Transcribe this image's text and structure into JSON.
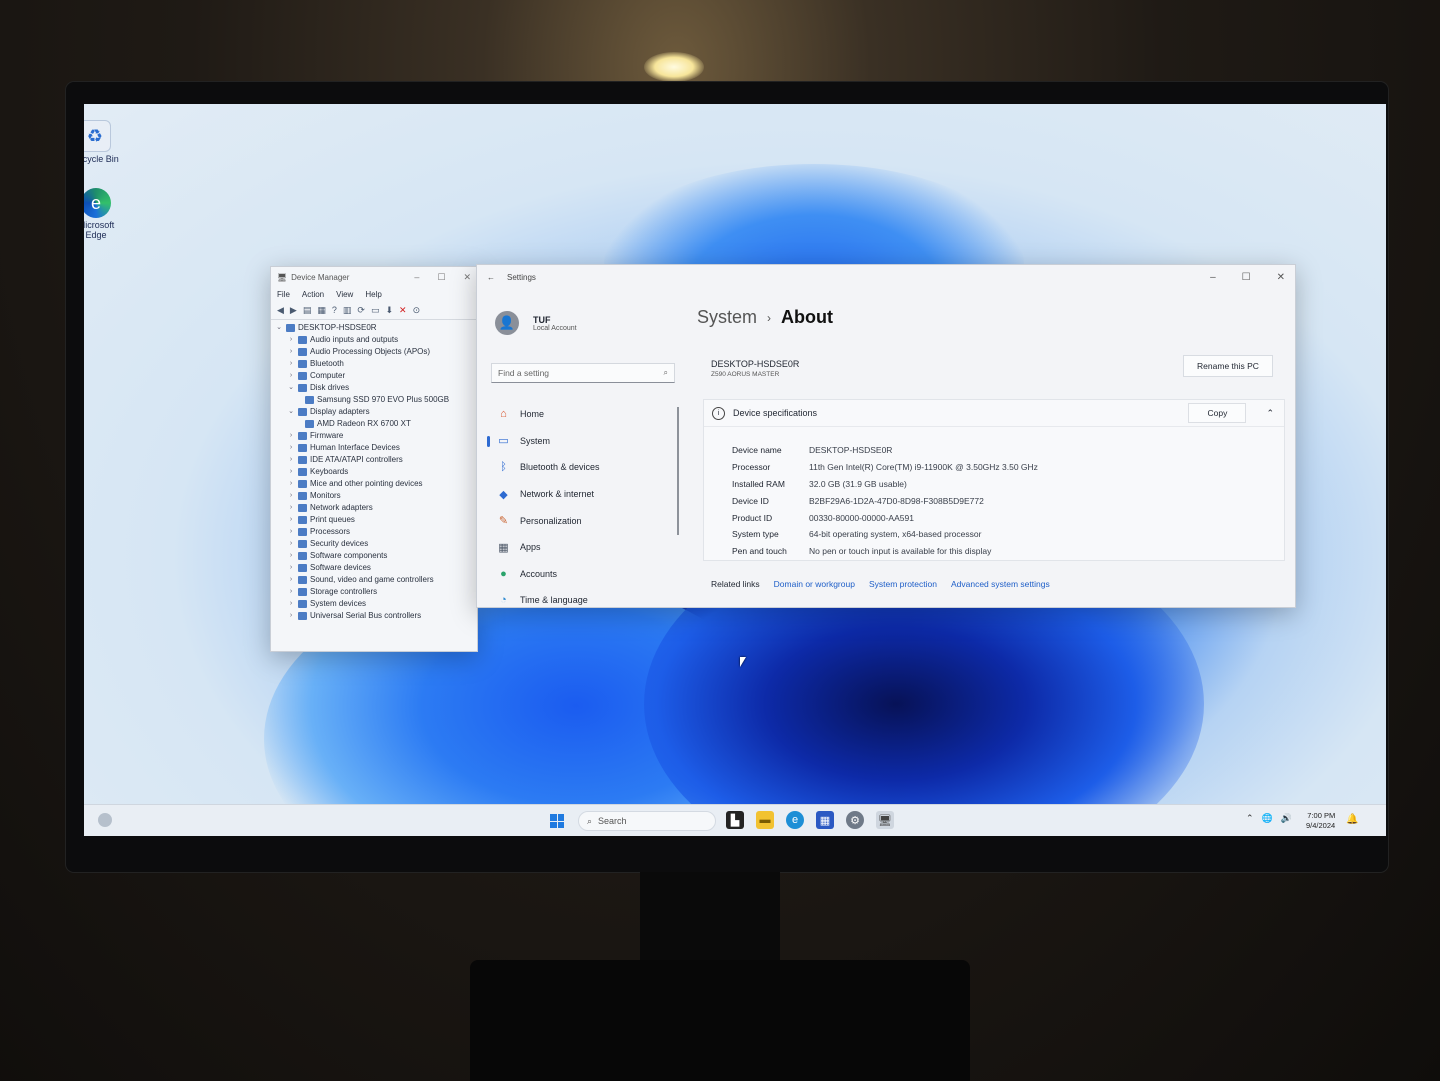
{
  "desktop": {
    "icons": [
      {
        "label": "Recycle Bin",
        "icon": "recycle-bin-icon"
      },
      {
        "label": "Microsoft Edge",
        "icon": "edge-icon"
      }
    ]
  },
  "device_manager": {
    "title": "Device Manager",
    "menu": [
      "File",
      "Action",
      "View",
      "Help"
    ],
    "tree": [
      {
        "label": "DESKTOP-HSDSE0R",
        "level": 0,
        "expanded": true
      },
      {
        "label": "Audio inputs and outputs",
        "level": 1
      },
      {
        "label": "Audio Processing Objects (APOs)",
        "level": 1
      },
      {
        "label": "Bluetooth",
        "level": 1
      },
      {
        "label": "Computer",
        "level": 1
      },
      {
        "label": "Disk drives",
        "level": 1,
        "expanded": true
      },
      {
        "label": "Samsung SSD 970 EVO Plus 500GB",
        "level": 2
      },
      {
        "label": "Display adapters",
        "level": 1,
        "expanded": true
      },
      {
        "label": "AMD Radeon RX 6700 XT",
        "level": 2
      },
      {
        "label": "Firmware",
        "level": 1
      },
      {
        "label": "Human Interface Devices",
        "level": 1
      },
      {
        "label": "IDE ATA/ATAPI controllers",
        "level": 1
      },
      {
        "label": "Keyboards",
        "level": 1
      },
      {
        "label": "Mice and other pointing devices",
        "level": 1
      },
      {
        "label": "Monitors",
        "level": 1
      },
      {
        "label": "Network adapters",
        "level": 1
      },
      {
        "label": "Print queues",
        "level": 1
      },
      {
        "label": "Processors",
        "level": 1
      },
      {
        "label": "Security devices",
        "level": 1
      },
      {
        "label": "Software components",
        "level": 1
      },
      {
        "label": "Software devices",
        "level": 1
      },
      {
        "label": "Sound, video and game controllers",
        "level": 1
      },
      {
        "label": "Storage controllers",
        "level": 1
      },
      {
        "label": "System devices",
        "level": 1
      },
      {
        "label": "Universal Serial Bus controllers",
        "level": 1
      }
    ]
  },
  "settings": {
    "title": "Settings",
    "profile": {
      "name": "TUF",
      "account": "Local Account"
    },
    "search_placeholder": "Find a setting",
    "nav": [
      {
        "label": "Home",
        "icon": "home-icon",
        "active": false
      },
      {
        "label": "System",
        "icon": "system-icon",
        "active": true
      },
      {
        "label": "Bluetooth & devices",
        "icon": "bluetooth-icon",
        "active": false
      },
      {
        "label": "Network & internet",
        "icon": "network-icon",
        "active": false
      },
      {
        "label": "Personalization",
        "icon": "brush-icon",
        "active": false
      },
      {
        "label": "Apps",
        "icon": "apps-icon",
        "active": false
      },
      {
        "label": "Accounts",
        "icon": "accounts-icon",
        "active": false
      },
      {
        "label": "Time & language",
        "icon": "time-icon",
        "active": false
      }
    ],
    "breadcrumb": {
      "parent": "System",
      "current": "About"
    },
    "device_name": "DESKTOP-HSDSE0R",
    "device_model": "Z590 AORUS MASTER",
    "rename_label": "Rename this PC",
    "specs_title": "Device specifications",
    "copy_label": "Copy",
    "specs": [
      {
        "key": "Device name",
        "value": "DESKTOP-HSDSE0R"
      },
      {
        "key": "Processor",
        "value": "11th Gen Intel(R) Core(TM) i9-11900K @ 3.50GHz   3.50 GHz"
      },
      {
        "key": "Installed RAM",
        "value": "32.0 GB (31.9 GB usable)"
      },
      {
        "key": "Device ID",
        "value": "B2BF29A6-1D2A-47D0-8D98-F308B5D9E772"
      },
      {
        "key": "Product ID",
        "value": "00330-80000-00000-AA591"
      },
      {
        "key": "System type",
        "value": "64-bit operating system, x64-based processor"
      },
      {
        "key": "Pen and touch",
        "value": "No pen or touch input is available for this display"
      }
    ],
    "related_label": "Related links",
    "related_links": [
      "Domain or workgroup",
      "System protection",
      "Advanced system settings"
    ]
  },
  "taskbar": {
    "search_placeholder": "Search",
    "time": "7:00 PM",
    "date": "9/4/2024"
  },
  "colors": {
    "accent": "#1f5fc8",
    "start": "#1f7ae0"
  }
}
